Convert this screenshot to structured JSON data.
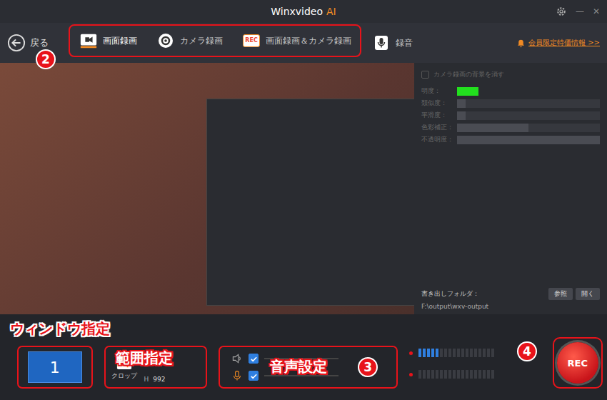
{
  "window": {
    "title": "Winxvideo",
    "title_accent": "AI",
    "controls": [
      "—",
      "✕"
    ]
  },
  "toolbar": {
    "back": "戻る",
    "tabs": [
      {
        "label": "画面録画",
        "kind": "screen",
        "badge": "",
        "selected": true
      },
      {
        "label": "カメラ録画",
        "kind": "camera",
        "badge": "",
        "selected": false
      },
      {
        "label": "画面録画＆カメラ録画",
        "kind": "rec",
        "badge": "REC",
        "selected": false
      }
    ],
    "audio_tab": {
      "label": "録音",
      "selected": false
    },
    "promo": "会員限定特価情報 >>"
  },
  "camera_panel": {
    "remove_background": {
      "label": "カメラ録画の背景を消す",
      "checked": false,
      "disabled": true
    },
    "settings": [
      {
        "label": "明度：",
        "kind": "color",
        "color": "#22e01e"
      },
      {
        "label": "類似度：",
        "kind": "slider",
        "level": 0.06
      },
      {
        "label": "平滑度：",
        "kind": "slider",
        "level": 0.06
      },
      {
        "label": "色彩補正：",
        "kind": "slider",
        "level": 0.5
      },
      {
        "label": "不透明度：",
        "kind": "slider",
        "level": 1.0
      }
    ]
  },
  "output": {
    "label": "書き出しフォルダ：",
    "path": "F:\\output\\wxv-output",
    "buttons": [
      "参照",
      "開く"
    ]
  },
  "controls": {
    "monitor": "1",
    "crop": {
      "label": "クロップ",
      "height_label": "H",
      "height": "992"
    },
    "audio": [
      {
        "kind": "speaker",
        "checked": true
      },
      {
        "kind": "mic",
        "checked": true
      }
    ],
    "meters": [
      {
        "level": 0.3
      },
      {
        "level": 0
      }
    ],
    "rec": "REC"
  },
  "annotations": {
    "window_select": "ウィンドウ指定",
    "range_select": "範囲指定",
    "audio_settings": "音声設定",
    "steps": [
      "2",
      "3",
      "4"
    ]
  }
}
